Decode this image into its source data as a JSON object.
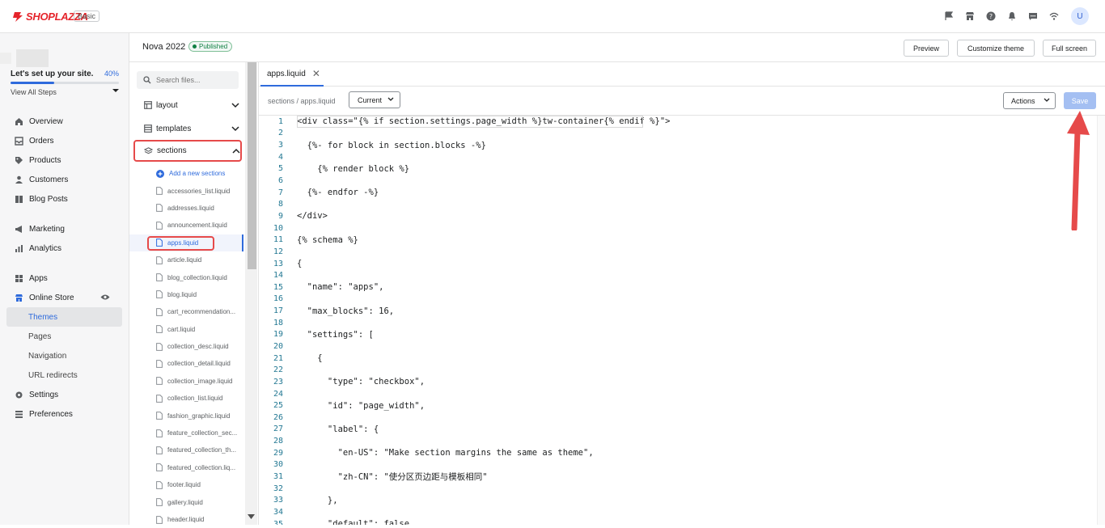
{
  "app": {
    "logo_text": "SHOPLAZZA",
    "plan": "Basic",
    "avatar_initial": "U",
    "brand_color": "#e5242b",
    "accent_color": "#2f6bdc"
  },
  "setup": {
    "title": "Let's set up your site.",
    "percent_label": "40%",
    "progress": 0.4,
    "view_steps": "View All Steps"
  },
  "nav": {
    "overview": "Overview",
    "orders": "Orders",
    "products": "Products",
    "customers": "Customers",
    "blog_posts": "Blog Posts",
    "marketing": "Marketing",
    "analytics": "Analytics",
    "apps": "Apps",
    "online_store": "Online Store",
    "themes": "Themes",
    "pages": "Pages",
    "navigation": "Navigation",
    "url_redirects": "URL redirects",
    "settings": "Settings",
    "preferences": "Preferences"
  },
  "header": {
    "theme_name": "Nova 2022",
    "status": "Published",
    "preview": "Preview",
    "customize": "Customize theme",
    "fullscreen": "Full screen"
  },
  "files": {
    "search_placeholder": "Search files...",
    "folders": {
      "layout": "layout",
      "templates": "templates",
      "sections": "sections"
    },
    "add_section": "Add a new sections",
    "items": [
      "accessories_list.liquid",
      "addresses.liquid",
      "announcement.liquid",
      "apps.liquid",
      "article.liquid",
      "blog_collection.liquid",
      "blog.liquid",
      "cart_recommendation...",
      "cart.liquid",
      "collection_desc.liquid",
      "collection_detail.liquid",
      "collection_image.liquid",
      "collection_list.liquid",
      "fashion_graphic.liquid",
      "feature_collection_sec...",
      "featured_collection_th...",
      "featured_collection.liq...",
      "footer.liquid",
      "gallery.liquid",
      "header.liquid"
    ]
  },
  "editor": {
    "tab": "apps.liquid",
    "breadcrumb": "sections / apps.liquid",
    "version": "Current",
    "actions": "Actions",
    "save": "Save",
    "lines": [
      "<div class=\"{% if section.settings.page_width %}tw-container{% endif %}\">",
      "",
      "  {%- for block in section.blocks -%}",
      "",
      "    {% render block %}",
      "",
      "  {%- endfor -%}",
      "",
      "</div>",
      "",
      "{% schema %}",
      "",
      "{",
      "",
      "  \"name\": \"apps\",",
      "",
      "  \"max_blocks\": 16,",
      "",
      "  \"settings\": [",
      "",
      "    {",
      "",
      "      \"type\": \"checkbox\",",
      "",
      "      \"id\": \"page_width\",",
      "",
      "      \"label\": {",
      "",
      "        \"en-US\": \"Make section margins the same as theme\",",
      "",
      "        \"zh-CN\": \"使分区页边距与模板相同\"",
      "",
      "      },",
      "",
      "      \"default\": false"
    ]
  }
}
